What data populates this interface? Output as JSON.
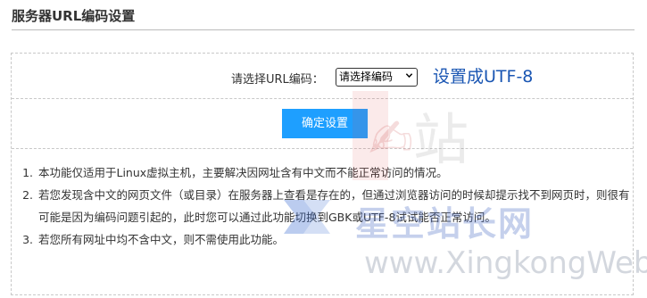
{
  "page": {
    "title": "服务器URL编码设置"
  },
  "form": {
    "encoding_label": "请选择URL编码：",
    "encoding_select": {
      "selected": "请选择编码"
    },
    "utf8_link": "设置成UTF-8",
    "confirm_label": "确定设置"
  },
  "notes": [
    "本功能仅适用于Linux虚拟主机，主要解决因网址含有中文而不能正常访问的情况。",
    "若您发现含中文的网页文件（或目录）在服务器上查看是存在的，但通过浏览器访问的时候却提示找不到网页时，则很有可能是因为编码问题引起的，此时您可以通过此功能切换到GBK或UTF-8试试能否正常访问。",
    "若您所有网址中均不含中文，则不需使用此功能。"
  ],
  "watermark": {
    "text_en": "www.XingkongWeb.com",
    "text_cn": "星空站长网",
    "stamp_text": "站"
  },
  "colors": {
    "accent": "#1e9fff",
    "link": "#1a56b3",
    "border": "#c8c8c8"
  },
  "icons": {
    "select_arrow": "chevron-down-icon"
  }
}
